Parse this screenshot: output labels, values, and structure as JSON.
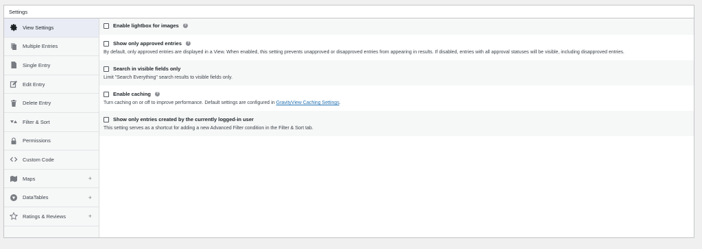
{
  "panel": {
    "title": "Settings"
  },
  "sidebar": {
    "items": [
      {
        "label": "View Settings",
        "icon": "gear-icon",
        "active": true,
        "expandable": false
      },
      {
        "label": "Multiple Entries",
        "icon": "copy-icon",
        "active": false,
        "expandable": false
      },
      {
        "label": "Single Entry",
        "icon": "document-icon",
        "active": false,
        "expandable": false
      },
      {
        "label": "Edit Entry",
        "icon": "edit-icon",
        "active": false,
        "expandable": false
      },
      {
        "label": "Delete Entry",
        "icon": "trash-icon",
        "active": false,
        "expandable": false
      },
      {
        "label": "Filter & Sort",
        "icon": "sort-icon",
        "active": false,
        "expandable": false
      },
      {
        "label": "Permissions",
        "icon": "lock-icon",
        "active": false,
        "expandable": false
      },
      {
        "label": "Custom Code",
        "icon": "code-icon",
        "active": false,
        "expandable": false
      },
      {
        "label": "Maps",
        "icon": "map-icon",
        "active": false,
        "expandable": true
      },
      {
        "label": "DataTables",
        "icon": "datatables-icon",
        "active": false,
        "expandable": true
      },
      {
        "label": "Ratings & Reviews",
        "icon": "star-icon",
        "active": false,
        "expandable": true
      }
    ],
    "expand_glyph": "+"
  },
  "settings": {
    "lightbox": {
      "label": "Enable lightbox for images",
      "checked": false
    },
    "approved": {
      "label": "Show only approved entries",
      "checked": false,
      "description": "By default, only approved entries are displayed in a View. When enabled, this setting prevents unapproved or disapproved entries from appearing in results. If disabled, entries with all approval statuses will be visible, including disapproved entries."
    },
    "search_visible": {
      "label": "Search in visible fields only",
      "checked": false,
      "description": "Limit \"Search Everything\" search results to visible fields only."
    },
    "caching": {
      "label": "Enable caching",
      "checked": false,
      "description_prefix": "Turn caching on or off to improve performance. Default settings are configured in ",
      "link_text": "GravityView Caching Settings",
      "description_suffix": "."
    },
    "logged_in": {
      "label": "Show only entries created by the currently logged-in user",
      "checked": false,
      "description": "This setting serves as a shortcut for adding a new Advanced Filter condition in the Filter & Sort tab."
    }
  },
  "help_glyph": "?",
  "colors": {
    "active_bg": "#e9ecf5",
    "link": "#2271b1",
    "border": "#c3c4c7"
  }
}
